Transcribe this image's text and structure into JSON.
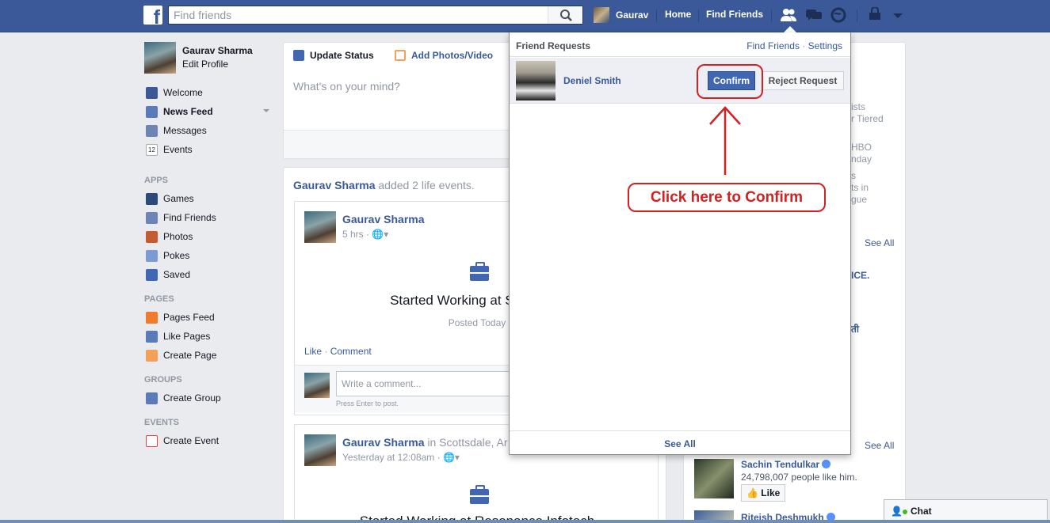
{
  "topbar": {
    "logo": "f",
    "search_placeholder": "Find friends",
    "user_name": "Gaurav",
    "home": "Home",
    "find_friends": "Find Friends",
    "icons": [
      "friend-requests-icon",
      "messages-icon",
      "notifications-icon",
      "privacy-shortcuts-icon",
      "account-menu-icon"
    ]
  },
  "profile": {
    "name": "Gaurav Sharma",
    "edit": "Edit Profile"
  },
  "nav": {
    "favorites": [
      "Welcome",
      "News Feed",
      "Messages",
      "Events"
    ],
    "events_badge": "12",
    "apps_heading": "APPS",
    "apps": [
      "Games",
      "Find Friends",
      "Photos",
      "Pokes",
      "Saved"
    ],
    "pages_heading": "PAGES",
    "pages": [
      "Pages Feed",
      "Like Pages",
      "Create Page"
    ],
    "groups_heading": "GROUPS",
    "groups": [
      "Create Group"
    ],
    "events_heading": "EVENTS",
    "events": [
      "Create Event"
    ]
  },
  "composer": {
    "update_status": "Update Status",
    "add_photos": "Add Photos/Video",
    "placeholder": "What's on your mind?"
  },
  "feed": {
    "header_name": "Gaurav Sharma",
    "header_action": "added 2 life events.",
    "post1": {
      "name": "Gaurav Sharma",
      "time": "5 hrs · ",
      "title": "Started Working at Sellskillz I",
      "sub": "Posted Today",
      "like": "Like",
      "sep": " · ",
      "comment": "Comment",
      "comment_placeholder": "Write a comment...",
      "hint": "Press Enter to post."
    },
    "post2": {
      "name": "Gaurav Sharma",
      "location": " in Scottsdale, Ar",
      "time": "Yesterday at 12:08am · ",
      "title": "Started Working at Resonance Infotech"
    }
  },
  "right": {
    "fragments": [
      "ists",
      "r Tiered",
      "HBO",
      "nday",
      "s",
      "ts in",
      "gue",
      "ICE.",
      "ती"
    ],
    "see_all_1": "See All",
    "see_all_2": "See All",
    "sachin_name": "Sachin Tendulkar",
    "sachin_likes": "24,798,007 people like him.",
    "like_label": "Like",
    "riteish": "Riteish Deshmukh"
  },
  "chat": {
    "label": "Chat"
  },
  "dropdown": {
    "title": "Friend Requests",
    "find_friends": "Find Friends",
    "dot": " · ",
    "settings": "Settings",
    "request_name": "Deniel Smith",
    "confirm": "Confirm",
    "reject": "Reject Request",
    "see_all": "See All"
  },
  "annotation": {
    "text": "Click here to Confirm",
    "color": "#d42020"
  },
  "colors": {
    "brand": "#3b5998",
    "confirm": "#4267b2",
    "background": "#e9ebee"
  }
}
